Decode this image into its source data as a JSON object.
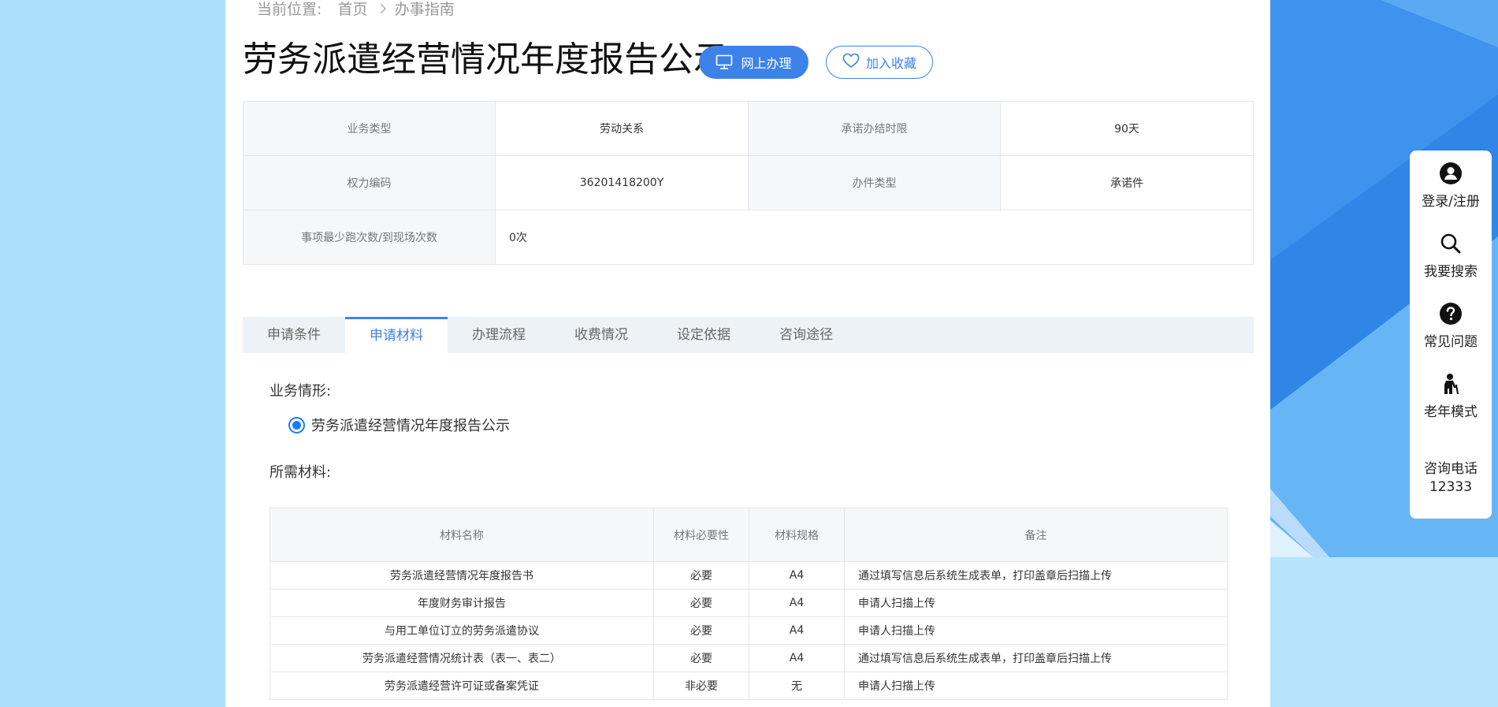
{
  "breadcrumb": {
    "prefix": "当前位置:",
    "home": "首页",
    "current": "办事指南"
  },
  "title": "劳务派遣经营情况年度报告公示",
  "buttons": {
    "online": "网上办理",
    "favorite": "加入收藏"
  },
  "info": {
    "business_type_label": "业务类型",
    "business_type_value": "劳动关系",
    "deadline_label": "承诺办结时限",
    "deadline_value": "90天",
    "power_code_label": "权力编码",
    "power_code_value": "36201418200Y",
    "case_type_label": "办件类型",
    "case_type_value": "承诺件",
    "visits_label": "事项最少跑次数/到现场次数",
    "visits_value": "0次"
  },
  "tabs": [
    "申请条件",
    "申请材料",
    "办理流程",
    "收费情况",
    "设定依据",
    "咨询途径"
  ],
  "active_tab": "申请材料",
  "scenario": {
    "label": "业务情形:",
    "option": "劳务派遣经营情况年度报告公示"
  },
  "materials": {
    "label": "所需材料:",
    "headers": [
      "材料名称",
      "材料必要性",
      "材料规格",
      "备注"
    ],
    "rows": [
      [
        "劳务派遣经营情况年度报告书",
        "必要",
        "A4",
        "通过填写信息后系统生成表单，打印盖章后扫描上传"
      ],
      [
        "年度财务审计报告",
        "必要",
        "A4",
        "申请人扫描上传"
      ],
      [
        "与用工单位订立的劳务派遣协议",
        "必要",
        "A4",
        "申请人扫描上传"
      ],
      [
        "劳务派遣经营情况统计表（表一、表二）",
        "必要",
        "A4",
        "通过填写信息后系统生成表单，打印盖章后扫描上传"
      ],
      [
        "劳务派遣经营许可证或备案凭证",
        "非必要",
        "无",
        "申请人扫描上传"
      ]
    ]
  },
  "side_panel": {
    "login": "登录/注册",
    "search": "我要搜索",
    "faq": "常见问题",
    "elder": "老年模式",
    "phone_label": "咨询电话",
    "phone_number": "12333"
  },
  "colors": {
    "accent": "#3d82e8",
    "page_bg": "#abdffb",
    "table_label_bg": "#f5f7f9"
  }
}
